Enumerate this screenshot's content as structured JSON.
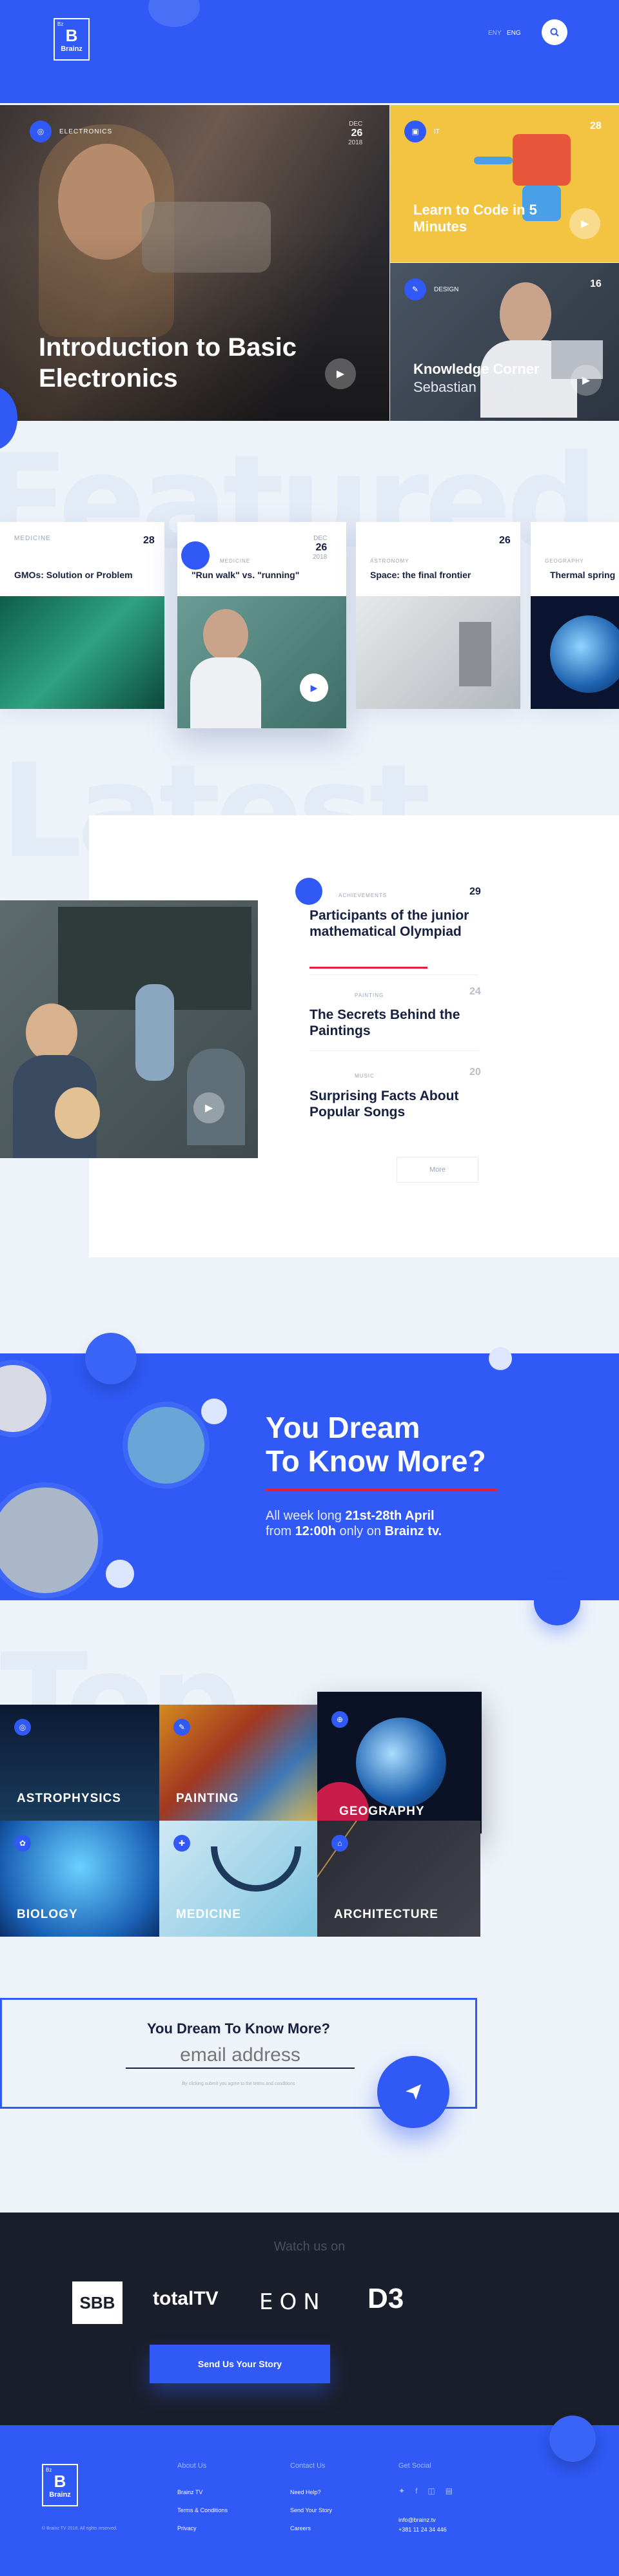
{
  "brand": {
    "logo_small": "Bz",
    "logo_letter": "B",
    "logo_word": "Brainz"
  },
  "header": {
    "lang_a": "ENY",
    "lang_b": "ENG"
  },
  "hero": {
    "main": {
      "category": "ELECTRONICS",
      "date_day": "26",
      "date_month": "DEC",
      "date_year": "2018",
      "title": "Introduction to Basic Electronics"
    },
    "side_top": {
      "category": "IT",
      "date_day": "28",
      "title": "Learn to Code in 5 Minutes"
    },
    "side_bottom": {
      "category": "DESIGN",
      "date_day": "16",
      "title": "Knowledge Corner",
      "author": "Sebastian Miller"
    }
  },
  "featured": {
    "ghost": "Featured",
    "cards": [
      {
        "title": "GMOs: Solution or Problem",
        "day": "28",
        "category": "MEDICINE"
      },
      {
        "title": "\"Run walk\" vs. \"running\"",
        "day": "26",
        "category": "MEDICINE",
        "month": "DEC",
        "year": "2018"
      },
      {
        "title": "Space: the final frontier",
        "day": "26",
        "category": "ASTRONOMY"
      },
      {
        "title": "Thermal spring",
        "category": "GEOGRAPHY"
      }
    ]
  },
  "latest": {
    "ghost": "Latest",
    "items": [
      {
        "title": "Participants of the junior mathematical Olympiad",
        "category": "ACHIEVEMENTS",
        "day": "29"
      },
      {
        "title": "The Secrets Behind the Paintings",
        "category": "PAINTING",
        "day": "24"
      },
      {
        "title": "Surprising Facts About Popular Songs",
        "category": "MUSIC",
        "day": "20"
      }
    ],
    "more": "More"
  },
  "promo": {
    "heading_line1": "You Dream",
    "heading_line2": "To Know More?",
    "text_a": "All week long ",
    "text_b": "21st-28th April",
    "text_c": "from ",
    "text_d": "12:00h",
    "text_e": " only on ",
    "text_f": "Brainz tv."
  },
  "picks": {
    "ghost": "Top picks",
    "tiles": [
      "ASTROPHYSICS",
      "PAINTING",
      "GEOGRAPHY",
      "BIOLOGY",
      "MEDICINE",
      "ARCHITECTURE"
    ]
  },
  "newsletter": {
    "title": "You Dream To Know More?",
    "placeholder": "email address",
    "note": "By clicking submit you agree to the terms and conditions"
  },
  "watch": {
    "label": "Watch us on",
    "channels": [
      "SBB",
      "totalTV",
      "EON",
      "D3"
    ],
    "button": "Send Us Your Story"
  },
  "footer": {
    "col1_title": "About Us",
    "col1": [
      "Brainz TV",
      "Terms & Conditions",
      "Privacy"
    ],
    "col2_title": "Contact Us",
    "col2": [
      "Need Help?",
      "Send Your Story",
      "Careers"
    ],
    "col3_title": "Get Social",
    "email": "info@brainz.tv",
    "phone": "+381 11 24 34 446",
    "copyright": "© Brainz TV 2018. All rights reserved."
  },
  "colors": {
    "accent": "#3059f5",
    "red": "#e2203a",
    "dark": "#1b1e2b"
  }
}
